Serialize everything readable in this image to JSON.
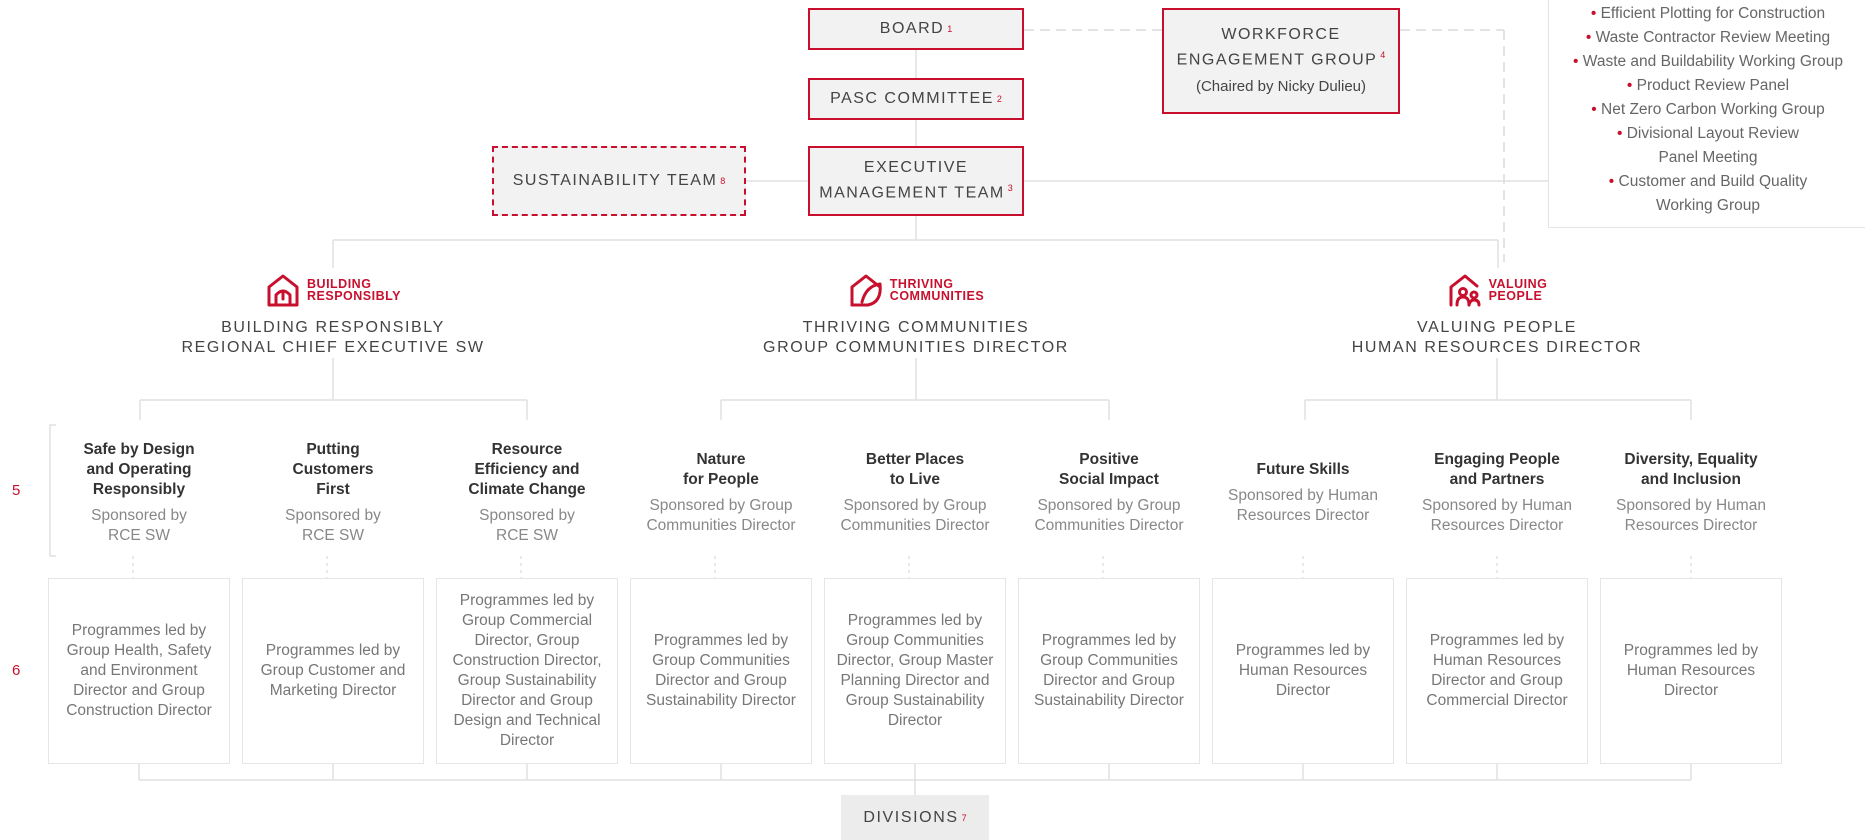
{
  "colors": {
    "accent": "#c8102e",
    "box_fill": "#f2f2f2",
    "line": "#e0e0e0"
  },
  "board": {
    "label": "BOARD",
    "ref": "1"
  },
  "pasc": {
    "label": "PASC COMMITTEE",
    "ref": "2"
  },
  "executive": {
    "line1": "EXECUTIVE",
    "line2": "MANAGEMENT TEAM",
    "ref": "3"
  },
  "sustainability": {
    "label": "SUSTAINABILITY TEAM",
    "ref": "8"
  },
  "workforce": {
    "line1": "WORKFORCE",
    "line2": "ENGAGEMENT GROUP",
    "ref": "4",
    "sub": "(Chaired by Nicky Dulieu)"
  },
  "groups_list": {
    "items": [
      "Efficient Plotting for Construction",
      "Waste Contractor Review Meeting",
      "Waste and Buildability Working Group",
      "Product Review Panel",
      "Net Zero Carbon Working Group",
      "Divisional Layout Review",
      "Panel Meeting",
      "Customer and Build Quality",
      "Working Group"
    ]
  },
  "pillars": [
    {
      "icon": "house-helmet-icon",
      "logo1": "BUILDING",
      "logo2": "RESPONSIBLY",
      "title1": "BUILDING RESPONSIBLY",
      "title2": "REGIONAL CHIEF EXECUTIVE SW"
    },
    {
      "icon": "house-leaf-icon",
      "logo1": "THRIVING",
      "logo2": "COMMUNITIES",
      "title1": "THRIVING COMMUNITIES",
      "title2": "GROUP COMMUNITIES DIRECTOR"
    },
    {
      "icon": "house-people-icon",
      "logo1": "VALUING",
      "logo2": "PEOPLE",
      "title1": "VALUING PEOPLE",
      "title2": "HUMAN RESOURCES DIRECTOR"
    }
  ],
  "row_labels": {
    "row5": "5",
    "row6": "6"
  },
  "columns": [
    {
      "title": [
        "Safe by Design",
        "and Operating",
        "Responsibly"
      ],
      "sponsor": [
        "Sponsored by",
        "RCE SW"
      ],
      "programme": [
        "Programmes led by",
        "Group Health, Safety",
        "and Environment",
        "Director and Group",
        "Construction Director"
      ]
    },
    {
      "title": [
        "Putting",
        "Customers",
        "First"
      ],
      "sponsor": [
        "Sponsored by",
        "RCE SW"
      ],
      "programme": [
        "Programmes led by",
        "Group Customer and",
        "Marketing Director"
      ]
    },
    {
      "title": [
        "Resource",
        "Efficiency and",
        "Climate Change"
      ],
      "sponsor": [
        "Sponsored by",
        "RCE SW"
      ],
      "programme": [
        "Programmes led by",
        "Group Commercial",
        "Director, Group",
        "Construction Director,",
        "Group Sustainability",
        "Director and Group",
        "Design and Technical",
        "Director"
      ]
    },
    {
      "title": [
        "Nature",
        "for People"
      ],
      "sponsor": [
        "Sponsored by Group",
        "Communities Director"
      ],
      "programme": [
        "Programmes led by",
        "Group Communities",
        "Director and Group",
        "Sustainability Director"
      ]
    },
    {
      "title": [
        "Better Places",
        "to Live"
      ],
      "sponsor": [
        "Sponsored by Group",
        "Communities Director"
      ],
      "programme": [
        "Programmes led by",
        "Group Communities",
        "Director, Group Master",
        "Planning Director and",
        "Group Sustainability",
        "Director"
      ]
    },
    {
      "title": [
        "Positive",
        "Social Impact"
      ],
      "sponsor": [
        "Sponsored by Group",
        "Communities Director"
      ],
      "programme": [
        "Programmes led by",
        "Group Communities",
        "Director and Group",
        "Sustainability Director"
      ]
    },
    {
      "title": [
        "Future Skills"
      ],
      "sponsor": [
        "Sponsored by Human",
        "Resources Director"
      ],
      "programme": [
        "Programmes led by",
        "Human Resources",
        "Director"
      ]
    },
    {
      "title": [
        "Engaging People",
        "and Partners"
      ],
      "sponsor": [
        "Sponsored by Human",
        "Resources Director"
      ],
      "programme": [
        "Programmes led by",
        "Human Resources",
        "Director and Group",
        "Commercial Director"
      ]
    },
    {
      "title": [
        "Diversity, Equality",
        "and Inclusion"
      ],
      "sponsor": [
        "Sponsored by Human",
        "Resources Director"
      ],
      "programme": [
        "Programmes led by",
        "Human Resources",
        "Director"
      ]
    }
  ],
  "divisions": {
    "label": "DIVISIONS",
    "ref": "7"
  }
}
